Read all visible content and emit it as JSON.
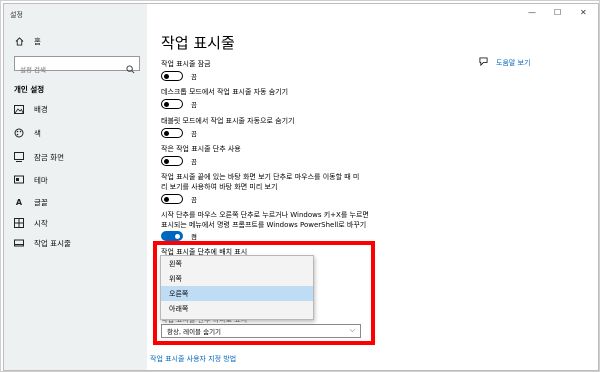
{
  "window": {
    "app_title": "설정",
    "min": "—",
    "max": "☐",
    "close": "✕"
  },
  "sidebar": {
    "home_label": "홈",
    "search_placeholder": "설정 검색",
    "section_title": "개인 설정",
    "items": [
      {
        "label": "배경",
        "icon": "background-icon"
      },
      {
        "label": "색",
        "icon": "color-icon"
      },
      {
        "label": "잠금 화면",
        "icon": "lock-screen-icon"
      },
      {
        "label": "테마",
        "icon": "theme-icon"
      },
      {
        "label": "글꼴",
        "icon": "font-icon"
      },
      {
        "label": "시작",
        "icon": "start-icon"
      },
      {
        "label": "작업 표시줄",
        "icon": "taskbar-icon"
      }
    ]
  },
  "main": {
    "title": "작업 표시줄",
    "help_label": "도움말 보기",
    "settings": [
      {
        "label": "작업 표시줄 잠금",
        "state": "끔",
        "on": false
      },
      {
        "label": "데스크톱 모드에서 작업 표시줄 자동 숨기기",
        "state": "끔",
        "on": false
      },
      {
        "label": "태블릿 모드에서 작업 표시줄 자동으로 숨기기",
        "state": "끔",
        "on": false
      },
      {
        "label": "작은 작업 표시줄 단추 사용",
        "state": "끔",
        "on": false
      },
      {
        "label_line1": "작업 표시줄 끝에 있는 바탕 화면 보기 단추로 마우스를 이동할 때 미",
        "label_line2": "리 보기를 사용하여 바탕 화면 미리 보기",
        "state": "끔",
        "on": false
      },
      {
        "label_line1": "시작 단추를 마우스 오른쪽 단추로 누르거나 Windows 키+X를 누르면",
        "label_line2": "표시되는 메뉴에서 명령 프롬프트를 Windows PowerShell로 바꾸기",
        "state": "켬",
        "on": true
      }
    ],
    "position_label": "작업 표시줄 단추에 배치 표시",
    "position_options": [
      "왼쪽",
      "위쪽",
      "오른쪽",
      "아래쪽"
    ],
    "position_selected": "오른쪽",
    "combine_label_partial": "작업 표시줄 단추 하나로 표시",
    "combine_value": "항상, 레이블 숨기기",
    "customize_link": "작업 표시줄 사용자 지정 방법"
  }
}
